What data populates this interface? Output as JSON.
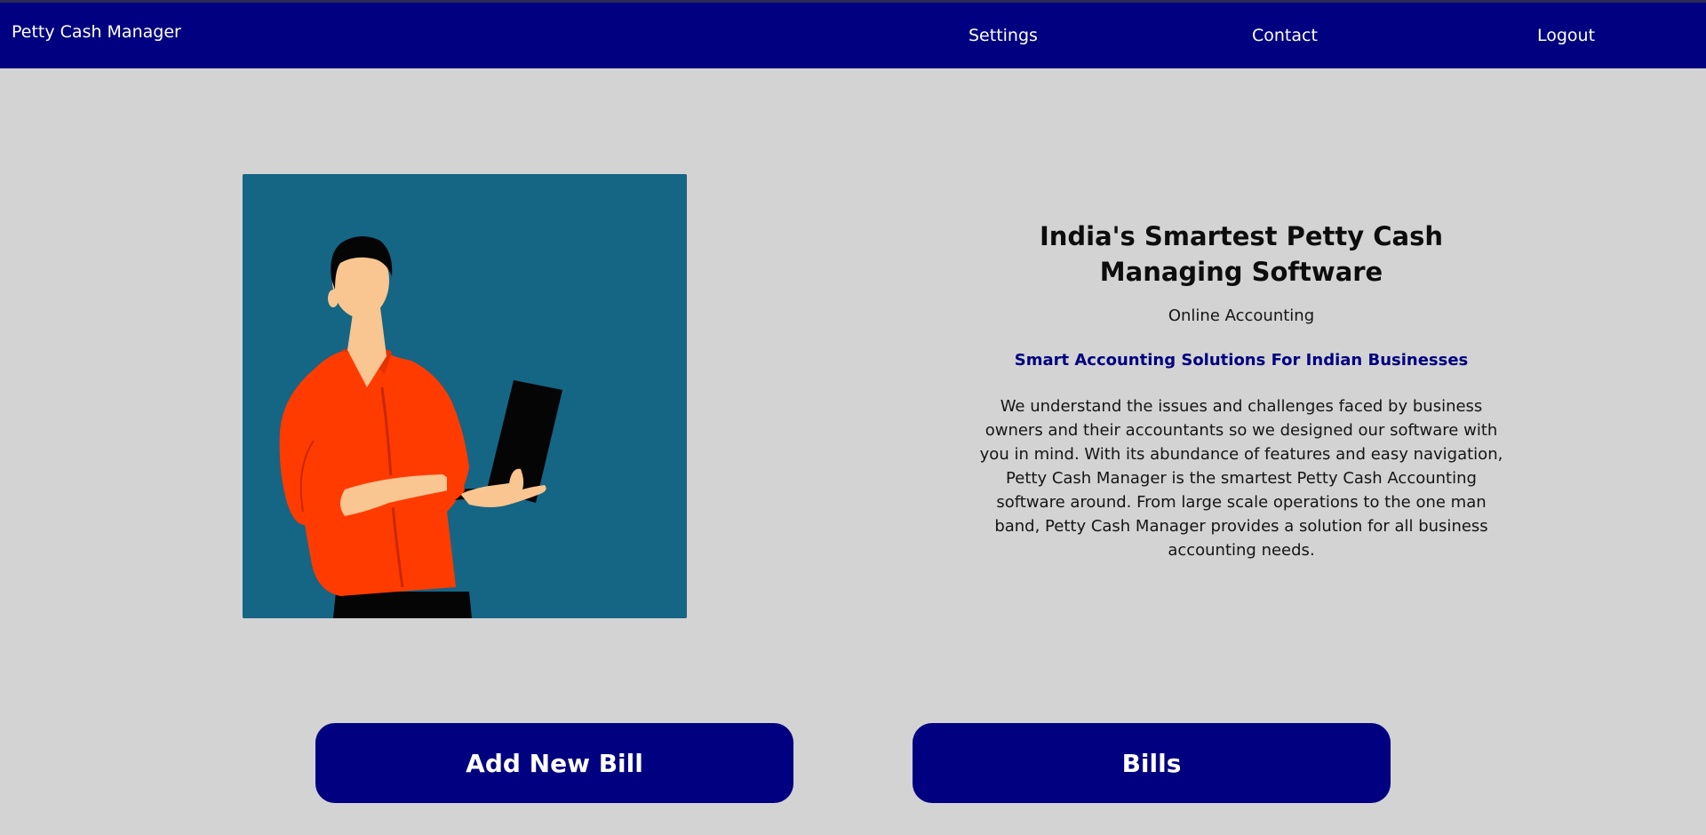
{
  "navbar": {
    "brand": "Petty Cash Manager",
    "links": [
      "Settings",
      "Contact",
      "Logout"
    ]
  },
  "hero": {
    "image_icon": "person-with-laptop-illustration"
  },
  "info": {
    "headline": "India's Smartest Petty Cash Managing Software",
    "subtitle": "Online Accounting",
    "tagline": "Smart Accounting Solutions For Indian Businesses",
    "description": "We understand the issues and challenges faced by business owners and their accountants so we designed our software with you in mind. With its abundance of features and easy navigation, Petty Cash Manager is the smartest Petty Cash Accounting software around. From large scale operations to the one man band, Petty Cash Manager provides a solution for all business accounting needs."
  },
  "actions": {
    "add_new_bill": "Add New Bill",
    "bills": "Bills"
  },
  "colors": {
    "navbar_bg": "#000080",
    "page_bg": "#d3d3d3",
    "image_bg": "#156584",
    "shirt": "#ff3b00",
    "skin": "#f9c590",
    "tagline": "#000080"
  }
}
